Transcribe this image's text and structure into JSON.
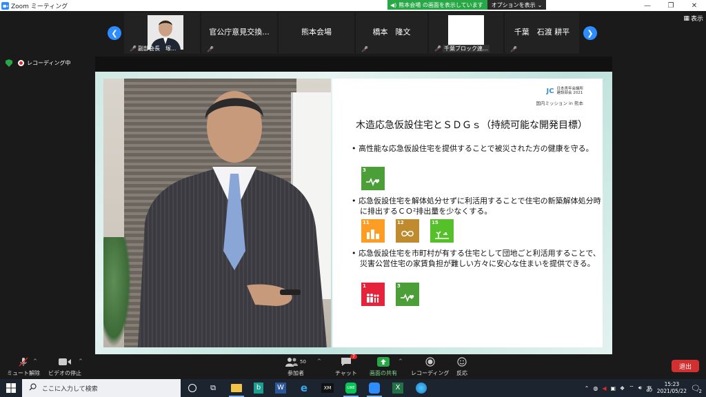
{
  "window": {
    "title": "Zoom ミーティング"
  },
  "share_banner": {
    "text": "熊本会場 の画面を表示しています",
    "options": "オプションを表示"
  },
  "view_button": "表示",
  "gallery": [
    {
      "name": "",
      "sub": "副部会長　塚..."
    },
    {
      "name": "官公庁意見交換...",
      "sub": ""
    },
    {
      "name": "熊本会場",
      "sub": ""
    },
    {
      "name": "橋本　隆文",
      "sub": ""
    },
    {
      "name": "",
      "sub": "千葉ブロック連..."
    },
    {
      "name": "千葉　石渡 耕平",
      "sub": ""
    }
  ],
  "recording": {
    "label": "レコーディング中"
  },
  "slide": {
    "logo_line1": "日本青年会議所",
    "logo_line2": "建設部会 2021",
    "mission": "国内ミッション in 熊本",
    "title": "木造応急仮設住宅とＳＤＧｓ（持続可能な開発目標）",
    "bullets": [
      "• 高性能な応急仮設住宅を提供することで被災された方の健康を守る。",
      "• 応急仮設住宅を解体処分せずに利活用することで住宅の新築解体処分時に排出するＣＯ²排出量を少なくする。",
      "• 応急仮設住宅を市町村が有する住宅として団地ごと利活用することで、災害公営住宅の家賃負担が難しい方々に安心な住まいを提供できる。"
    ],
    "sdg_group1": [
      {
        "num": "3",
        "color": "#4c9f38"
      }
    ],
    "sdg_group2": [
      {
        "num": "11",
        "color": "#fd9d24"
      },
      {
        "num": "12",
        "color": "#bf8b2e"
      },
      {
        "num": "15",
        "color": "#56c02b"
      }
    ],
    "sdg_group3": [
      {
        "num": "1",
        "color": "#e5243b"
      },
      {
        "num": "3",
        "color": "#4c9f38"
      }
    ]
  },
  "toolbar": {
    "mute": "ミュート解除",
    "video": "ビデオの停止",
    "participants": "参加者",
    "participants_count": "50",
    "chat": "チャット",
    "chat_badge": "7",
    "share": "画面の共有",
    "record": "レコーディング",
    "reactions": "反応",
    "leave": "退出"
  },
  "taskbar": {
    "search_placeholder": "ここに入力して検索",
    "time": "15:23",
    "date": "2021/05/22",
    "ime": "あ",
    "notifications": "2"
  }
}
